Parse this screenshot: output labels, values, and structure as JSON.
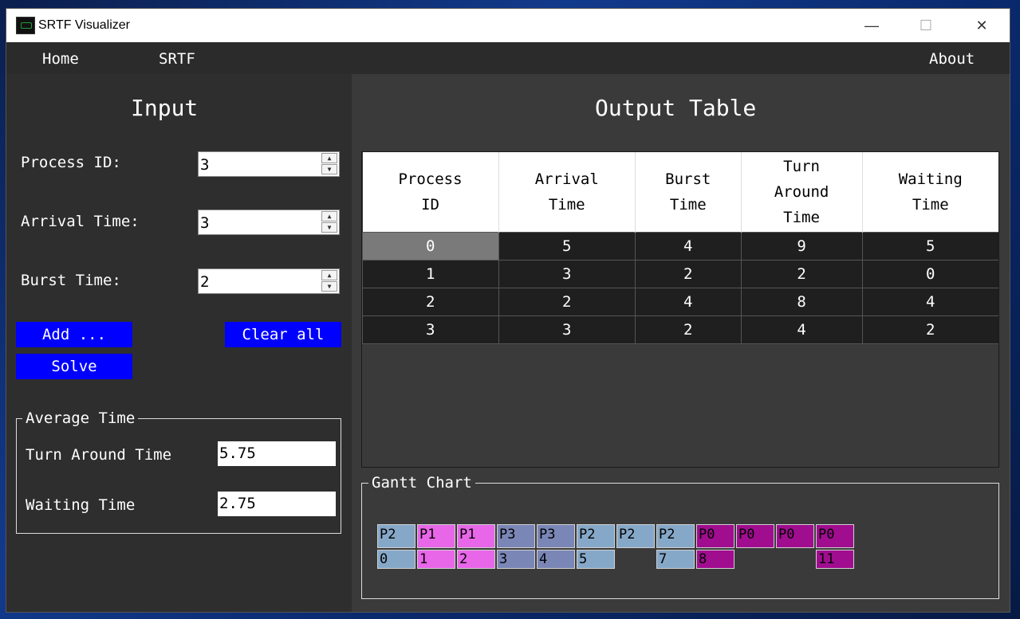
{
  "window": {
    "title": "SRTF Visualizer",
    "minimize": "—",
    "maximize": "☐",
    "close": "✕"
  },
  "menu": {
    "home": "Home",
    "srtf": "SRTF",
    "about": "About"
  },
  "input": {
    "heading": "Input",
    "process_id_label": "Process ID:",
    "process_id_value": "3",
    "arrival_label": "Arrival Time:",
    "arrival_value": "3",
    "burst_label": "Burst Time:",
    "burst_value": "2",
    "add_label": "Add ...",
    "clear_label": "Clear all",
    "solve_label": "Solve",
    "spin_up": "▲",
    "spin_down": "▼"
  },
  "average": {
    "legend": "Average Time",
    "tat_label": "Turn Around Time",
    "tat_value": "5.75",
    "wt_label": "Waiting Time",
    "wt_value": "2.75"
  },
  "output": {
    "heading": "Output Table",
    "columns": [
      [
        "Process",
        "ID"
      ],
      [
        "Arrival",
        "Time"
      ],
      [
        "Burst",
        "Time"
      ],
      [
        "Turn",
        "Around",
        "Time"
      ],
      [
        "Waiting",
        "Time"
      ]
    ],
    "rows": [
      [
        "0",
        "5",
        "4",
        "9",
        "5"
      ],
      [
        "1",
        "3",
        "2",
        "2",
        "0"
      ],
      [
        "2",
        "2",
        "4",
        "8",
        "4"
      ],
      [
        "3",
        "3",
        "2",
        "4",
        "2"
      ]
    ]
  },
  "gantt": {
    "legend": "Gantt Chart",
    "colors": {
      "P0": "#a00d8f",
      "P1": "#e866e8",
      "P2": "#86a8c8",
      "P3": "#7a86b6"
    },
    "blocks": [
      {
        "label": "P2",
        "time": "0"
      },
      {
        "label": "P1",
        "time": "1"
      },
      {
        "label": "P1",
        "time": "2"
      },
      {
        "label": "P3",
        "time": "3"
      },
      {
        "label": "P3",
        "time": "4"
      },
      {
        "label": "P2",
        "time": "5"
      },
      {
        "label": "P2",
        "time": ""
      },
      {
        "label": "P2",
        "time": "7"
      },
      {
        "label": "P0",
        "time": "8"
      },
      {
        "label": "P0",
        "time": ""
      },
      {
        "label": "P0",
        "time": ""
      },
      {
        "label": "P0",
        "time": "11"
      }
    ]
  }
}
